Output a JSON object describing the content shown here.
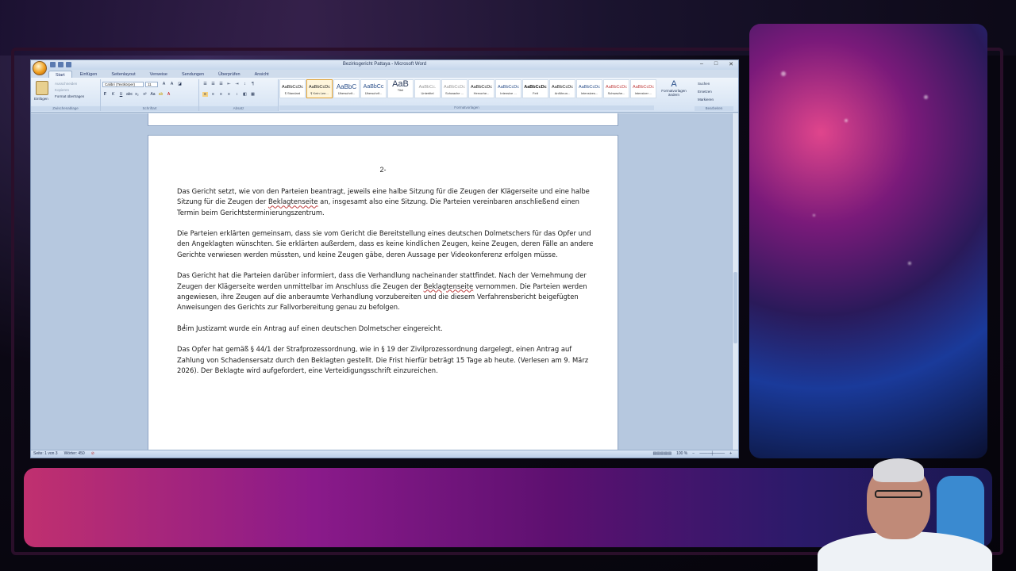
{
  "window": {
    "title": "Bezirksgericht Pattaya - Microsoft Word"
  },
  "ribbon_tabs": [
    "Start",
    "Einfügen",
    "Seitenlayout",
    "Verweise",
    "Sendungen",
    "Überprüfen",
    "Ansicht"
  ],
  "clipboard": {
    "paste": "Einfügen",
    "cut": "Ausschneiden",
    "copy": "Kopieren",
    "format_painter": "Format übertragen",
    "group": "Zwischenablage"
  },
  "font": {
    "name": "Calibri (Textkörper)",
    "size": "11",
    "group": "Schriftart"
  },
  "paragraph": {
    "group": "Absatz"
  },
  "styles": {
    "group": "Formatvorlagen",
    "items": [
      {
        "preview": "AaBbCcDc",
        "name": "¶ Standard"
      },
      {
        "preview": "AaBbCcDc",
        "name": "¶ Kein Lee..."
      },
      {
        "preview": "AaBbC",
        "name": "Überschrif..."
      },
      {
        "preview": "AaBbCc",
        "name": "Überschrif..."
      },
      {
        "preview": "AaB",
        "name": "Titel"
      },
      {
        "preview": "AaBbCc.",
        "name": "Untertitel"
      },
      {
        "preview": "AaBbCcDc",
        "name": "Schwache ..."
      },
      {
        "preview": "AaBbCcDc",
        "name": "Hervorhe..."
      },
      {
        "preview": "AaBbCcDc",
        "name": "Intensive ..."
      },
      {
        "preview": "AaBbCcDc",
        "name": "Fett"
      },
      {
        "preview": "AaBbCcDc",
        "name": "Anführun..."
      },
      {
        "preview": "AaBbCcDc",
        "name": "Intensives..."
      },
      {
        "preview": "AaBbCcDc",
        "name": "Schwache..."
      },
      {
        "preview": "AaBbCcDc",
        "name": "Intensiver ..."
      }
    ],
    "change": "Formatvorlagen ändern"
  },
  "editing": {
    "find": "Suchen",
    "replace": "Ersetzen",
    "select": "Markieren",
    "group": "Bearbeiten"
  },
  "document": {
    "page_number": "2-",
    "p1": [
      "Das Gericht setzt, wie von den Parteien beantragt, jeweils eine halbe Sitzung für die Zeugen der Klägerseite und eine halbe Sitzung für die Zeugen der ",
      "Beklagtenseite",
      " an, insgesamt also eine Sitzung. Die Parteien vereinbaren anschließend einen Termin beim Gerichtsterminierungszentrum."
    ],
    "p2": "Die Parteien erklärten gemeinsam, dass sie vom Gericht die Bereitstellung eines deutschen Dolmetschers für das Opfer und den Angeklagten wünschten. Sie erklärten außerdem, dass es keine kindlichen Zeugen, keine Zeugen, deren Fälle an andere Gerichte verwiesen werden müssten, und keine Zeugen gäbe, deren Aussage per Videokonferenz erfolgen müsse.",
    "p3": [
      "Das Gericht hat die Parteien darüber informiert, dass die Verhandlung nacheinander stattfindet. Nach der Vernehmung der Zeugen der Klägerseite werden unmittelbar im Anschluss die Zeugen der ",
      "Beklagtenseite",
      " vernommen. Die Parteien werden angewiesen, ihre Zeugen auf die anberaumte Verhandlung vorzubereiten und die diesem Verfahrensbericht beigefügten Anweisungen des Gerichts zur Fallvorbereitung genau zu befolgen."
    ],
    "p4": "Beim Justizamt wurde ein Antrag auf einen deutschen Dolmetscher eingereicht.",
    "p5": "Das Opfer hat gemäß § 44/1 der Strafprozessordnung, wie in § 19 der Zivilprozessordnung dargelegt, einen Antrag auf Zahlung von Schadensersatz durch den Beklagten gestellt. Die Frist hierfür beträgt 15 Tage ab heute. (Verlesen am 9. März 2026). Der Beklagte wird aufgefordert, eine Verteidigungsschrift einzureichen."
  },
  "status": {
    "page": "Seite: 1 von 3",
    "words": "Wörter: 450",
    "zoom": "100 %"
  }
}
